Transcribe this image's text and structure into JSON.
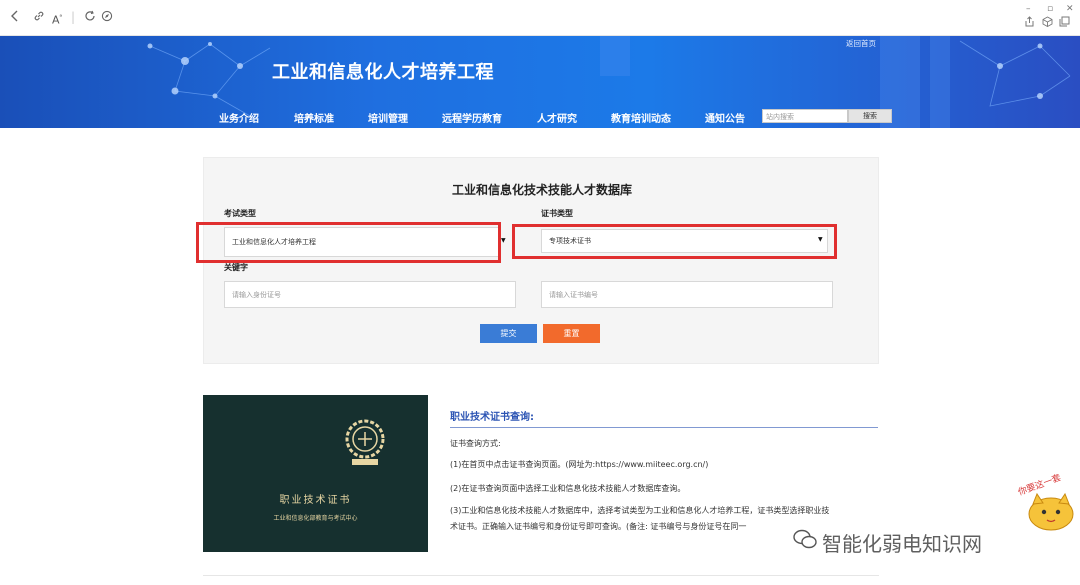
{
  "browser": {
    "back_icon": "chevron-left-icon",
    "link_icon": "link-icon",
    "read_icon": "read-aloud-icon",
    "refresh_icon": "refresh-icon",
    "compass_icon": "compass-icon"
  },
  "header": {
    "title": "工业和信息化人才培养工程",
    "home_link": "返回首页",
    "nav": [
      "业务介绍",
      "培养标准",
      "培训管理",
      "远程学历教育",
      "人才研究",
      "教育培训动态",
      "通知公告"
    ],
    "search_placeholder": "站内搜索",
    "search_button": "搜索"
  },
  "query": {
    "title": "工业和信息化技术技能人才数据库",
    "exam_type_label": "考试类型",
    "exam_type_value": "工业和信息化人才培养工程",
    "cert_type_label": "证书类型",
    "cert_type_value": "专项技术证书",
    "keyword_label": "关键字",
    "id_placeholder": "请输入身份证号",
    "cert_no_placeholder": "请输入证书编号",
    "submit_label": "提交",
    "reset_label": "重置"
  },
  "certificate": {
    "title": "职业技术证书",
    "subtitle": "工业和信息化部教育与考试中心"
  },
  "info": {
    "heading": "职业技术证书查询:",
    "p1": "证书查询方式:",
    "p2": "(1)在首页中点击证书查询页面。(网址为:https://www.miiteec.org.cn/)",
    "p3": "(2)在证书查询页面中选择工业和信息化技术技能人才数据库查询。",
    "p4a": "(3)工业和信息化技术技能人才数据库中，选择考试类型为工业和信息化人才培养工程，证书类型选择职业技",
    "p4b": "术证书。正确输入证书编号和身份证号即可查询。(备注: 证书编号与身份证号在同一"
  },
  "watermark": {
    "text": "智能化弱电知识网",
    "sticker_text": "你要这一套"
  },
  "colors": {
    "banner": "#1f6fe0",
    "highlight": "#e02f2f",
    "submit": "#3a7cd6",
    "reset": "#f26a2c",
    "cert_bg": "#16302f"
  }
}
